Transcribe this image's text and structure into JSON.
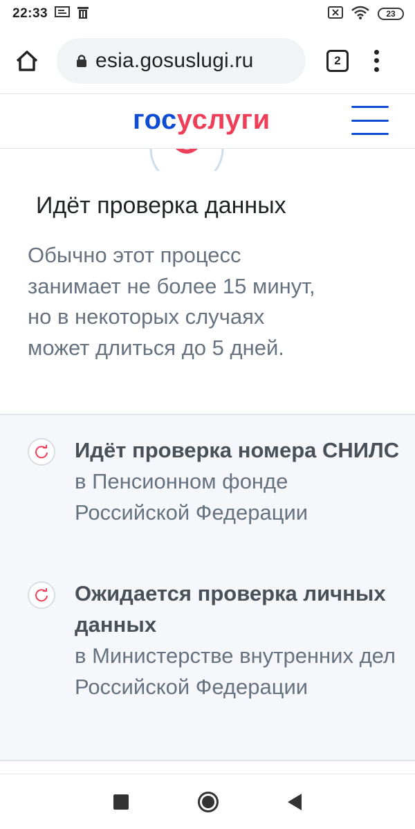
{
  "status_bar": {
    "time": "22:33",
    "battery": "23",
    "icons": [
      "cast-icon",
      "trash-icon",
      "sim-x-icon",
      "wifi-icon",
      "battery-icon"
    ]
  },
  "browser": {
    "url": "esia.gosuslugi.ru",
    "tab_count": "2",
    "icons": [
      "home-icon",
      "lock-icon",
      "menu-dots-icon"
    ]
  },
  "header": {
    "logo_part1": "гос",
    "logo_part2": "услуги",
    "colors": {
      "blue": "#0d4cd3",
      "red": "#ee3f58"
    }
  },
  "main": {
    "title": "Идёт проверка данных",
    "description": "Обычно этот процесс занимает не более 15 минут, но в некоторых случаях может длиться до 5 дней."
  },
  "steps": [
    {
      "title": "Идёт проверка номера СНИЛС",
      "subtitle": "в Пенсионном фонде Российской Федерации",
      "icon": "refresh-icon"
    },
    {
      "title": "Ожидается проверка личных данных",
      "subtitle": "в Министерстве внутренних дел Российской Федерации",
      "icon": "refresh-icon"
    }
  ],
  "nav": {
    "icons": [
      "recent-apps-icon",
      "home-circle-icon",
      "back-icon"
    ]
  }
}
